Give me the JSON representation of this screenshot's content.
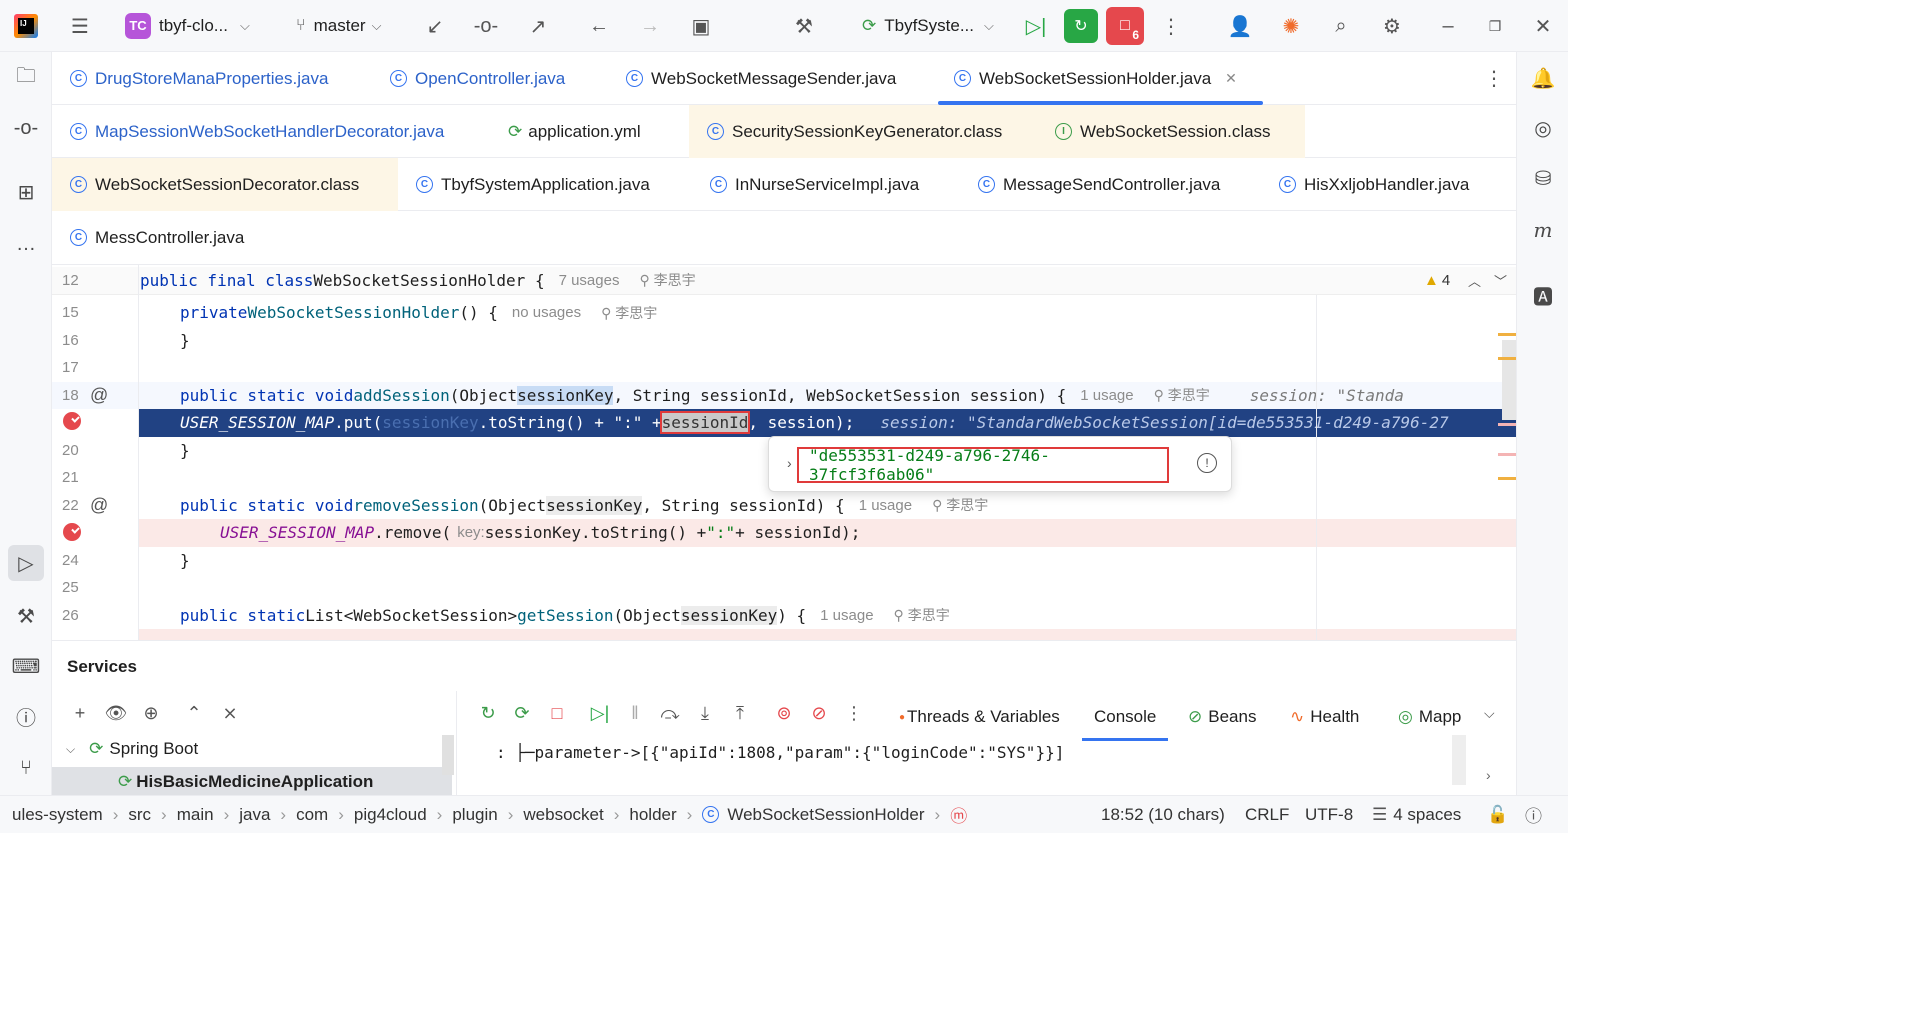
{
  "titlebar": {
    "project_badge": "TC",
    "project_name": "tbyf-clo...",
    "branch": "master",
    "run_config": "TbyfSyste...",
    "debug_count": "6"
  },
  "tabs": {
    "row1": [
      "DrugStoreManaProperties.java",
      "OpenController.java",
      "WebSocketMessageSender.java",
      "WebSocketSessionHolder.java"
    ],
    "row2": [
      "MapSessionWebSocketHandlerDecorator.java",
      "application.yml",
      "SecuritySessionKeyGenerator.class",
      "WebSocketSession.class"
    ],
    "row3": [
      "WebSocketSessionDecorator.class",
      "TbyfSystemApplication.java",
      "InNurseServiceImpl.java",
      "MessageSendController.java",
      "HisXxljobHandler.java"
    ],
    "row4": [
      "MessController.java"
    ]
  },
  "editor": {
    "warnings": "4",
    "lines": [
      {
        "n": "12",
        "parts": [
          [
            "kw",
            "public final class "
          ],
          [
            "",
            "WebSocketSessionHolder { "
          ]
        ],
        "hint": "7 usages",
        "user": "李思宇"
      },
      {
        "n": "15",
        "parts": [
          [
            "kw",
            "private "
          ],
          [
            "fn",
            "WebSocketSessionHolder"
          ],
          [
            "",
            "() {"
          ]
        ],
        "hint": "no usages",
        "user": "李思宇"
      },
      {
        "n": "16",
        "parts": [
          [
            "",
            "}"
          ]
        ]
      },
      {
        "n": "17",
        "parts": [
          [
            "",
            ""
          ]
        ]
      },
      {
        "n": "18",
        "parts": [
          [
            "kw",
            "public static void "
          ],
          [
            "fn",
            "addSession"
          ],
          [
            "",
            "(Object "
          ],
          [
            "sel",
            "sessionKey"
          ],
          [
            "",
            ", String sessionId, WebSocketSession session) {"
          ]
        ],
        "hint": "1 usage",
        "user": "李思宇",
        "debug": "session: \"Standa"
      },
      {
        "n": "",
        "parts": [
          [
            "it",
            "USER_SESSION_MAP"
          ],
          [
            "",
            ".put("
          ],
          [
            "dim",
            "sessionKey"
          ],
          [
            "",
            ".toString() + \":\" + "
          ],
          [
            "box",
            "sessionId"
          ],
          [
            "",
            ", session);"
          ]
        ],
        "debug": "session: \"StandardWebSocketSession[id=de553531-d249-a796-27"
      },
      {
        "n": "20",
        "parts": [
          [
            "",
            "}"
          ]
        ]
      },
      {
        "n": "21",
        "parts": [
          [
            "",
            ""
          ]
        ]
      },
      {
        "n": "22",
        "parts": [
          [
            "kw",
            "public static void "
          ],
          [
            "fn",
            "removeSession"
          ],
          [
            "",
            "(Object "
          ],
          [
            "sel2",
            "sessionKey"
          ],
          [
            "",
            ", String sessionId) {"
          ]
        ],
        "hint": "1 usage",
        "user": "李思宇"
      },
      {
        "n": "",
        "parts": [
          [
            "it",
            "USER_SESSION_MAP"
          ],
          [
            "",
            ".remove("
          ],
          [
            "param",
            "key:"
          ],
          [
            "",
            " sessionKey.toString() + "
          ],
          [
            "st",
            "\":\""
          ],
          [
            "",
            " + sessionId);"
          ]
        ]
      },
      {
        "n": "24",
        "parts": [
          [
            "",
            "}"
          ]
        ]
      },
      {
        "n": "25",
        "parts": [
          [
            "",
            ""
          ]
        ]
      },
      {
        "n": "26",
        "parts": [
          [
            "kw",
            "public static "
          ],
          [
            "",
            "List<WebSocketSession> "
          ],
          [
            "fn",
            "getSession"
          ],
          [
            "",
            "(Object "
          ],
          [
            "sel2",
            "sessionKey"
          ],
          [
            "",
            ") {"
          ]
        ],
        "hint": "1 usage",
        "user": "李思宇"
      }
    ]
  },
  "tooltip": {
    "value": "\"de553531-d249-a796-2746-37fcf3f6ab06\""
  },
  "services": {
    "title": "Services",
    "tree_root": "Spring Boot",
    "tree_child": "HisBasicMedicineApplication",
    "tabs": [
      "Threads & Variables",
      "Console",
      "Beans",
      "Health",
      "Mapp"
    ],
    "console_line": ":  ├─parameter->[{\"apiId\":1808,\"param\":{\"loginCode\":\"SYS\"}}]"
  },
  "statusbar": {
    "breadcrumb": [
      "ules-system",
      "src",
      "main",
      "java",
      "com",
      "pig4cloud",
      "plugin",
      "websocket",
      "holder",
      "WebSocketSessionHolder"
    ],
    "position": "18:52 (10 chars)",
    "line_sep": "CRLF",
    "encoding": "UTF-8",
    "indent": "4 spaces"
  }
}
